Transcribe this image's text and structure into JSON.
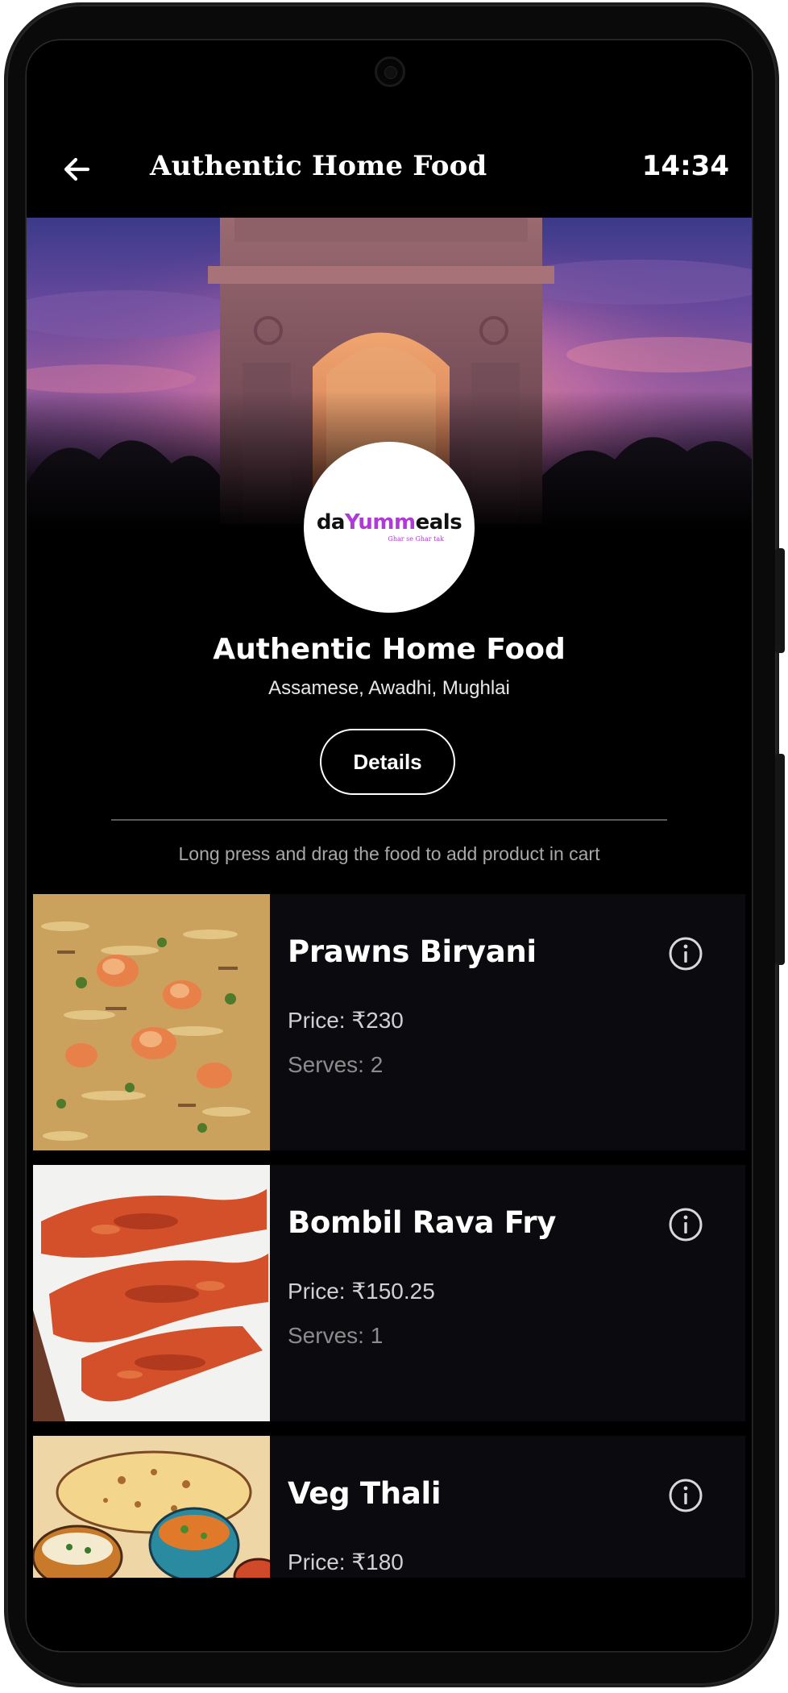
{
  "app_bar": {
    "title": "Authentic Home Food",
    "clock": "14:34"
  },
  "icons": {
    "back": "arrow-left-icon",
    "info": "info-circle-icon"
  },
  "logo": {
    "text_prefix": "da",
    "text_accent": "Yumm",
    "text_suffix": "eals",
    "tagline": "Ghar se Ghar tak",
    "accent_color": "#b03ad6"
  },
  "vendor": {
    "name": "Authentic Home Food",
    "cuisines": "Assamese, Awadhi, Mughlai",
    "details_label": "Details"
  },
  "hint": "Long press and drag the food to add product in cart",
  "foods": [
    {
      "name": "Prawns Biryani",
      "price": "Price: ₹230",
      "serves": "Serves: 2"
    },
    {
      "name": "Bombil Rava Fry",
      "price": "Price: ₹150.25",
      "serves": "Serves: 1"
    },
    {
      "name": "Veg Thali",
      "price": "Price: ₹180",
      "serves": ""
    }
  ],
  "colors": {
    "background": "#000000",
    "card": "#0b0b0f",
    "text_primary": "#ffffff",
    "text_secondary": "#a8a8a8"
  }
}
